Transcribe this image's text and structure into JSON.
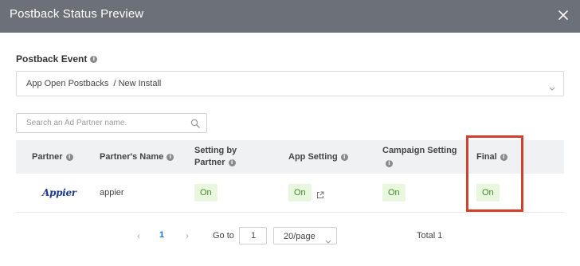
{
  "dialog": {
    "title": "Postback Status Preview"
  },
  "icons": {
    "close": "close-icon",
    "info": "info-icon",
    "chevron": "chevron-down-icon",
    "search": "search-icon",
    "external": "external-link-icon"
  },
  "postback_event": {
    "label": "Postback Event",
    "value": "App Open Postbacks  / New Install"
  },
  "search": {
    "placeholder": "Search an Ad Partner name.",
    "value": ""
  },
  "table": {
    "columns": {
      "partner": "Partner",
      "partner_name": "Partner's Name",
      "setting_by_partner_line1": "Setting by",
      "setting_by_partner_line2": "Partner",
      "app_setting": "App Setting",
      "campaign_setting": "Campaign Setting",
      "final": "Final"
    },
    "rows": [
      {
        "partner_logo": "Appier",
        "partner_name": "appier",
        "setting_by_partner": "On",
        "app_setting": "On",
        "campaign_setting": "On",
        "final": "On"
      }
    ]
  },
  "colors": {
    "title_bar": "#6b7079",
    "badge_bg": "#e8f7de",
    "badge_text": "#3f8a2a",
    "highlight": "#d0402c",
    "link": "#1a73c8"
  },
  "pagination": {
    "prev": "‹",
    "current_page": "1",
    "next": "›",
    "goto_label": "Go to",
    "goto_value": "1",
    "page_size": "20/page",
    "total": "Total 1"
  }
}
